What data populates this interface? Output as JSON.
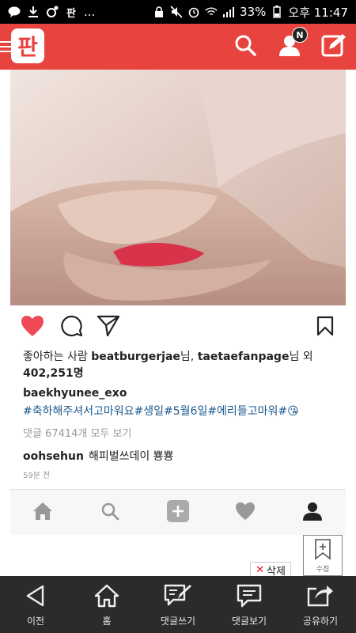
{
  "status_bar": {
    "left_icons": [
      "kakaotalk-icon",
      "download-icon",
      "notification-icon",
      "pann-icon"
    ],
    "ellipsis": "...",
    "battery": "33%",
    "time": "오후 11:47"
  },
  "header": {
    "logo": "판",
    "notification_badge": "N"
  },
  "post": {
    "likes_prefix": "좋아하는 사람 ",
    "liker1": "beatburgerjae",
    "honorific1": "님, ",
    "liker2": "taetaefanpage",
    "honorific2": "님 외",
    "likes_count": "402,251명",
    "username": "baekhyunee_exo",
    "hashtags": "#축하해주셔서고마워요#생일#5월6일#에리들고마워#",
    "emoji": "😘",
    "view_all_comments": "댓글 67414개 모두 보기",
    "comment_user": "oohsehun",
    "comment_text": "해피벌쓰데이 뿅뿅",
    "time_ago": "59분 전"
  },
  "floating": {
    "bookmark_label": "수집",
    "delete_label": "삭제"
  },
  "bottom_nav": [
    {
      "label": "이전"
    },
    {
      "label": "홈"
    },
    {
      "label": "댓글쓰기"
    },
    {
      "label": "댓글보기"
    },
    {
      "label": "공유하기"
    }
  ],
  "colors": {
    "header_bg": "#e8443f",
    "heart_red": "#ed4956",
    "hashtag_blue": "#1d5a8e",
    "bottom_nav_bg": "#2b2b2b"
  }
}
